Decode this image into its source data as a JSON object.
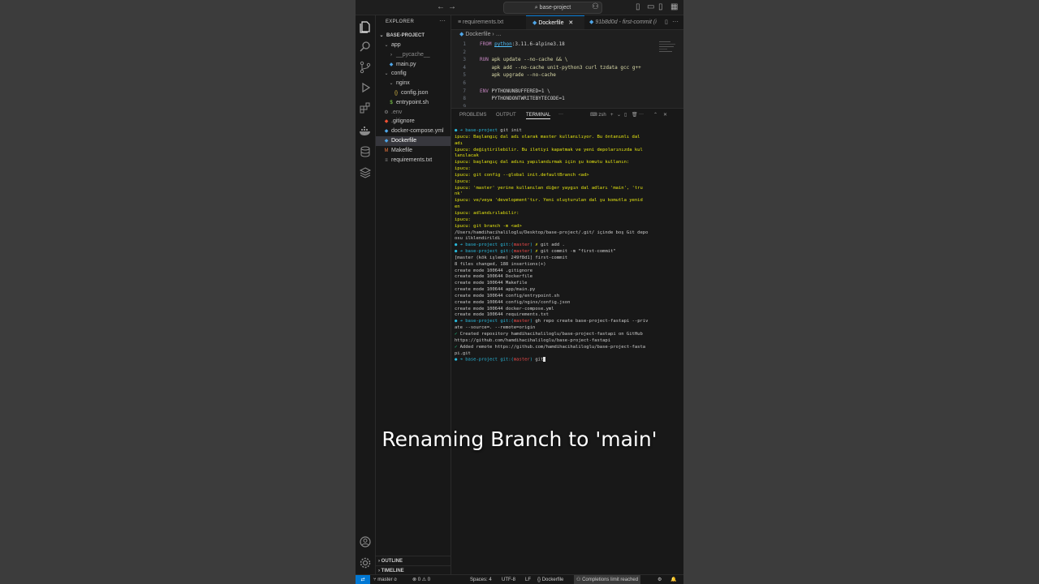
{
  "titlebar": {
    "search_label": "base-project"
  },
  "explorer": {
    "header": "EXPLORER",
    "project": "BASE-PROJECT",
    "items": [
      {
        "label": "app",
        "icon": "chevron-down-icon",
        "indent": 1,
        "color": "#cccccc"
      },
      {
        "label": "__pycache__",
        "icon": "chevron-right-icon",
        "indent": 2,
        "color": "#8b8b8b"
      },
      {
        "label": "main.py",
        "icon": "python-icon",
        "indent": 2,
        "color": "#cccccc"
      },
      {
        "label": "config",
        "icon": "chevron-down-icon",
        "indent": 1,
        "color": "#cccccc"
      },
      {
        "label": "nginx",
        "icon": "chevron-down-icon",
        "indent": 2,
        "color": "#cccccc"
      },
      {
        "label": "config.json",
        "icon": "json-icon",
        "indent": 3,
        "color": "#cccccc"
      },
      {
        "label": "entrypoint.sh",
        "icon": "shell-icon",
        "indent": 2,
        "color": "#cccccc"
      },
      {
        "label": ".env",
        "icon": "gear-icon",
        "indent": 1,
        "color": "#8b8b8b"
      },
      {
        "label": ".gitignore",
        "icon": "git-icon",
        "indent": 1,
        "color": "#cccccc"
      },
      {
        "label": "docker-compose.yml",
        "icon": "docker-icon",
        "indent": 1,
        "color": "#cccccc"
      },
      {
        "label": "Dockerfile",
        "icon": "docker-icon",
        "indent": 1,
        "color": "#ffffff",
        "selected": true
      },
      {
        "label": "Makefile",
        "icon": "makefile-icon",
        "indent": 1,
        "color": "#cccccc"
      },
      {
        "label": "requirements.txt",
        "icon": "text-file-icon",
        "indent": 1,
        "color": "#cccccc"
      }
    ],
    "outline": "OUTLINE",
    "timeline": "TIMELINE"
  },
  "tabs": [
    {
      "label": "requirements.txt"
    },
    {
      "label": "Dockerfile"
    },
    {
      "label": "91b8d0d - first-commit (i"
    }
  ],
  "breadcrumb": {
    "file": "Dockerfile",
    "more": "…"
  },
  "editor": {
    "lines": [
      {
        "n": "1",
        "html": "<span class=\"kw\">FROM</span> <span class=\"lnk\">python</span>:3.11.6-alpine3.18"
      },
      {
        "n": "2",
        "html": ""
      },
      {
        "n": "3",
        "html": "<span class=\"kw\">RUN</span> <span class=\"cmd\">apk update --no-cache &amp;&amp; \\</span>"
      },
      {
        "n": "4",
        "html": "    <span class=\"cmd\">apk add --no-cache unit-python3 curl tzdata gcc g++</span>"
      },
      {
        "n": "5",
        "html": "    <span class=\"cmd\">apk upgrade --no-cache</span>"
      },
      {
        "n": "6",
        "html": ""
      },
      {
        "n": "7",
        "html": "<span class=\"kw\">ENV</span> PYTHONUNBUFFERED=1 \\"
      },
      {
        "n": "8",
        "html": "    PYTHONDONTWRITEBYTECODE=1"
      },
      {
        "n": "9",
        "html": ""
      }
    ]
  },
  "panel": {
    "tabs": [
      "PROBLEMS",
      "OUTPUT",
      "TERMINAL"
    ],
    "shell": "zsh",
    "terminal": [
      "<span class=\"c\">● ➜ </span><span class=\"c\">base-project</span> git init",
      "<span class=\"y\">ipucu:  Başlangıç dal adı olarak master kullanılıyor. Bu öntanımlı dal</span>",
      "<span class=\"y\">adı</span>",
      "<span class=\"y\">ipucu:  değiştirilebilir. Bu iletiyi kapatmak ve yeni depolarınızda kul</span>",
      "<span class=\"y\">lanılacak</span>",
      "<span class=\"y\">ipucu:  başlangıç dal adını yapılandırmak için şu komutu kullanın:</span>",
      "<span class=\"y\">ipucu:</span>",
      "<span class=\"y\">ipucu:          git config --global init.defaultBranch &lt;ad&gt;</span>",
      "<span class=\"y\">ipucu:</span>",
      "<span class=\"y\">ipucu:  'master' yerine kullanılan diğer yaygın dal adları 'main', 'tru</span>",
      "<span class=\"y\">nk'</span>",
      "<span class=\"y\">ipucu:  ve/veya 'development'tır. Yeni oluşturulan dal şu komutla yenid</span>",
      "<span class=\"y\">en</span>",
      "<span class=\"y\">ipucu:  adlandırılabilir:</span>",
      "<span class=\"y\">ipucu:</span>",
      "<span class=\"y\">ipucu:          git branch -m &lt;ad&gt;</span>",
      "/Users/hamdihacihaliloglu/Desktop/base-project/.git/ içinde boş Git depo",
      "osu ilklendirildi",
      "<span class=\"c\">● ➜ </span><span class=\"c\">base-project</span> <span class=\"c\">git:(</span><span class=\"r\">master</span><span class=\"c\">)</span> <span class=\"y\">✗</span> git add .",
      "<span class=\"c\">● ➜ </span><span class=\"c\">base-project</span> <span class=\"c\">git:(</span><span class=\"r\">master</span><span class=\"c\">)</span> <span class=\"y\">✗</span> git commit -m \"first-commit\"",
      "[master (kök işleme) 249f8d1] first-commit",
      " 8 files changed, 188 insertions(+)",
      " create mode 100644 .gitignore",
      " create mode 100644 Dockerfile",
      " create mode 100644 Makefile",
      " create mode 100644 app/main.py",
      " create mode 100644 config/entrypoint.sh",
      " create mode 100644 config/nginx/config.json",
      " create mode 100644 docker-compose.yml",
      " create mode 100644 requirements.txt",
      "<span class=\"c\">● ➜ </span><span class=\"c\">base-project</span> <span class=\"c\">git:(</span><span class=\"r\">master</span><span class=\"c\">)</span> gh repo create base-project-fastapi --priv",
      "ate --source=. --remote=origin",
      "<span class=\"g\">✓</span> Created repository hamdihacihaliloglu/base-project-fastapi on GitHub",
      "  https://github.com/hamdihacihaliloglu/base-project-fastapi",
      "<span class=\"g\">✓</span> Added remote https://github.com/hamdihacihaliloglu/base-project-fasta",
      "pi.git",
      "<span class=\"c\">● ➜ </span><span class=\"c\">base-project</span> <span class=\"c\">git:(</span><span class=\"r\">master</span><span class=\"c\">)</span> git<span class=\"caret\"></span>"
    ]
  },
  "status": {
    "branch": "master",
    "errors": "0",
    "warnings": "0",
    "spaces": "Spaces: 4",
    "encoding": "UTF-8",
    "eol": "LF",
    "language": "Dockerfile",
    "completions": "Completions limit reached"
  },
  "caption": "Renaming Branch to 'main'"
}
